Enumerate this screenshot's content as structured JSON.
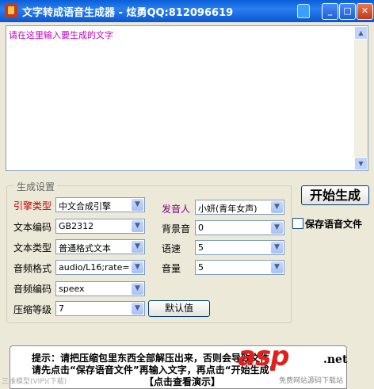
{
  "window": {
    "title": "文字转成语音生成器 - 炫勇QQ:812096619",
    "minimize_glyph": "_",
    "maximize_glyph": "□",
    "close_glyph": "✕"
  },
  "text_input": {
    "placeholder": "请在这里输入要生成的文字"
  },
  "settings": {
    "group_title": "生成设置",
    "engine_type": {
      "label": "引擎类型",
      "value": "中文合成引擎"
    },
    "text_encoding": {
      "label": "文本编码",
      "value": "GB2312"
    },
    "text_type": {
      "label": "文本类型",
      "value": "普通格式文本"
    },
    "audio_format": {
      "label": "音频格式",
      "value": "audio/L16;rate="
    },
    "audio_codec": {
      "label": "音频编码",
      "value": "speex"
    },
    "compression_level": {
      "label": "压缩等级",
      "value": "7"
    },
    "speaker": {
      "label": "发音人",
      "value": "小妍(青年女声)"
    },
    "background": {
      "label": "背景音",
      "value": "0"
    },
    "speed": {
      "label": "语速",
      "value": "5"
    },
    "volume": {
      "label": "音量",
      "value": "5"
    },
    "default_button": "默认值"
  },
  "actions": {
    "start_button": "开始生成",
    "save_checkbox_label": "保存语音文件",
    "save_checked": false
  },
  "notice": {
    "line1": "提示：请把压缩包里东西全部解压出来，否则会导致文件",
    "line2": "请先点击“保存语音文件”再输入文字，再点击“开始生成”",
    "line3": "【点击查看演示】"
  },
  "watermark": {
    "logo": "asp",
    "suffix": ".net",
    "caption": "免费网站源码下载站",
    "left_text": "三维模型(VIP)(下载)"
  },
  "colors": {
    "titlebar": "#0b57d0",
    "placeholder": "#c000c0",
    "label_red": "#c00000",
    "label_purple": "#7a007a",
    "watermark_red": "#e0201c"
  },
  "icons": {
    "app": "app-icon",
    "skin": "skin-icon",
    "dropdown": "chevron-down-icon"
  }
}
